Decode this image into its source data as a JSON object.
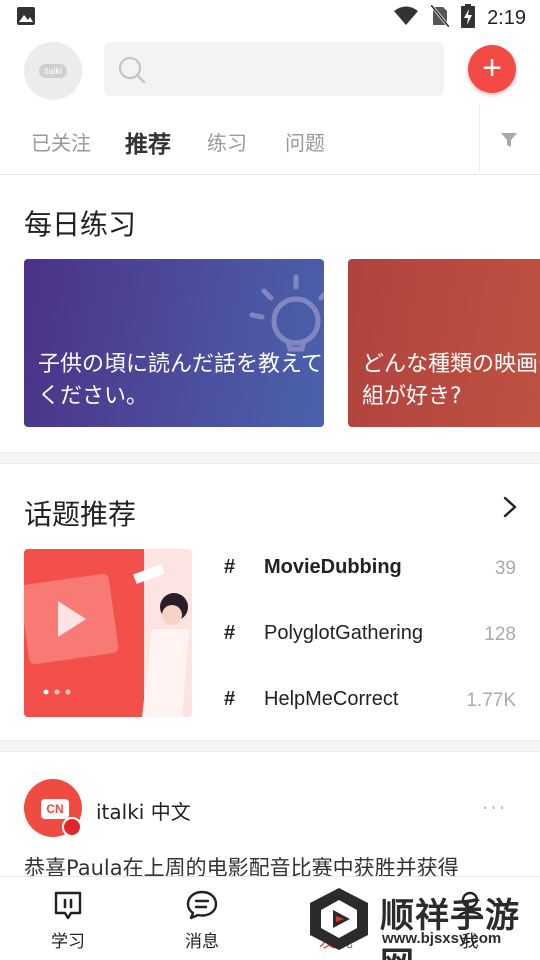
{
  "status_bar": {
    "time": "2:19"
  },
  "header": {
    "avatar_logo": "italki",
    "add_label": "+"
  },
  "tabs": [
    {
      "label": "已关注"
    },
    {
      "label": "推荐"
    },
    {
      "label": "练习"
    },
    {
      "label": "问题"
    }
  ],
  "daily_practice": {
    "title": "每日练习",
    "cards": [
      {
        "text": "子供の頃に読んだ話を教えてください。"
      },
      {
        "text": "どんな種類の映画やテレビ番組が好き?"
      }
    ]
  },
  "topics": {
    "title": "话题推荐",
    "items": [
      {
        "hash": "#",
        "name": "MovieDubbing",
        "count": "39"
      },
      {
        "hash": "#",
        "name": "PolyglotGathering",
        "count": "128"
      },
      {
        "hash": "#",
        "name": "HelpMeCorrect",
        "count": "1.77K"
      }
    ]
  },
  "post": {
    "badge": "CN",
    "author": "italki 中文",
    "more": "···",
    "text": "恭喜Paula在上周的电影配音比赛中获胜并获得"
  },
  "bottom_nav": [
    {
      "label": "学习"
    },
    {
      "label": "消息"
    },
    {
      "label": "发现"
    },
    {
      "label": "我"
    }
  ],
  "watermark": {
    "brand": "顺祥手游网",
    "url": "www.bjsxsy.com"
  },
  "colors": {
    "accent": "#f44a45",
    "card1": "#4c4f9f",
    "card2": "#b0423e"
  }
}
